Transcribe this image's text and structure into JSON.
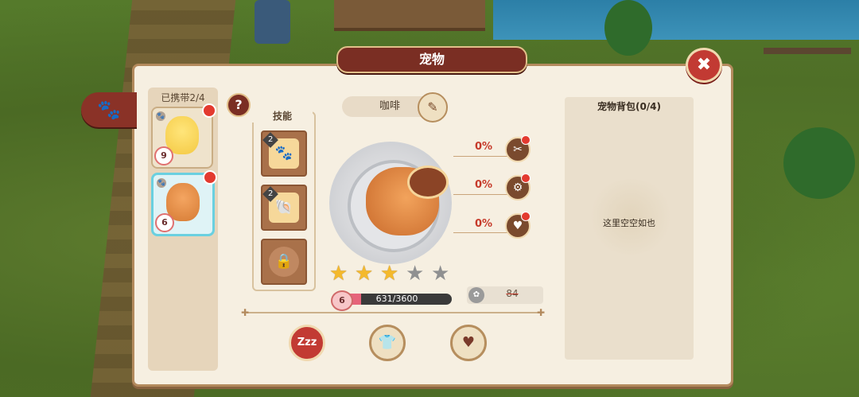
{
  "window": {
    "title": "宠物"
  },
  "carry": {
    "label": "已携带2/4"
  },
  "pets": [
    {
      "name": "chick",
      "level": "9",
      "type": "🐾"
    },
    {
      "name": "cat",
      "level": "6",
      "type": "🐾",
      "selected": true
    }
  ],
  "skills": {
    "header": "技能",
    "slots": [
      {
        "level": "2",
        "icon": "paw-bag-icon",
        "glyph": "🐾"
      },
      {
        "level": "2",
        "icon": "shell-icon",
        "glyph": "🐚"
      },
      {
        "icon": "lock-icon",
        "glyph": "🔒"
      }
    ]
  },
  "pet_detail": {
    "name": "咖啡",
    "stats": [
      {
        "value": "0%",
        "icon": "tools-icon",
        "glyph": "✂"
      },
      {
        "value": "0%",
        "icon": "gear-icon",
        "glyph": "⚙"
      },
      {
        "value": "0%",
        "icon": "heart-icon",
        "glyph": "♥"
      }
    ],
    "stars": {
      "filled": 3,
      "total": 5
    },
    "level": "6",
    "xp": {
      "text": "631/3600",
      "current": 631,
      "max": 3600
    },
    "cost": "84"
  },
  "actions": [
    {
      "label": "Zzz",
      "icon": "sleep-icon"
    },
    {
      "label": "👕",
      "icon": "shirt-icon"
    },
    {
      "label": "♥",
      "icon": "heart-icon"
    }
  ],
  "bag": {
    "title": "宠物背包(0/4)",
    "empty_text": "这里空空如也"
  },
  "colors": {
    "accent": "#7a2e23",
    "xp": "#e6647a",
    "star": "#f4b92c"
  }
}
